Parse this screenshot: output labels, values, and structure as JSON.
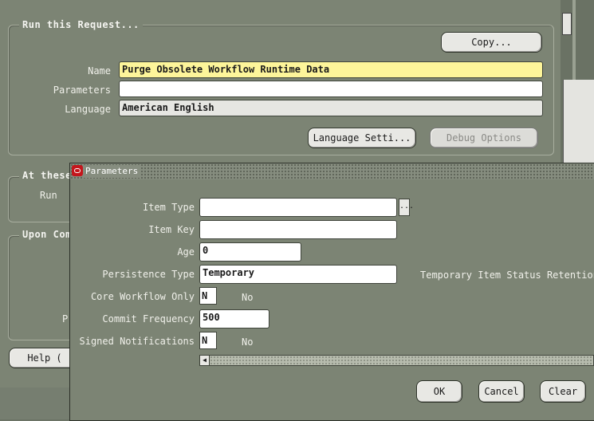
{
  "main": {
    "run_group_title": "Run this Request...",
    "copy_button": "Copy...",
    "name_label": "Name",
    "name_value": "Purge Obsolete Workflow Runtime Data",
    "parameters_label": "Parameters",
    "parameters_value": "",
    "language_label": "Language",
    "language_value": "American English",
    "language_settings_button": "Language Setti...",
    "debug_options_button": "Debug Options",
    "at_these_group_title": "At these",
    "run_label": "Run",
    "upon_group_title": "Upon Com",
    "p_label": "P",
    "help_button": "Help ("
  },
  "dialog": {
    "title": "Parameters",
    "item_type_label": "Item Type",
    "item_type_value": "",
    "lov_button": "...",
    "item_key_label": "Item Key",
    "item_key_value": "",
    "age_label": "Age",
    "age_value": "0",
    "persistence_type_label": "Persistence Type",
    "persistence_type_value": "Temporary",
    "persistence_desc": "Temporary Item Status Retention",
    "core_workflow_label": "Core Workflow Only",
    "core_workflow_value": "N",
    "core_workflow_desc": "No",
    "commit_frequency_label": "Commit Frequency",
    "commit_frequency_value": "500",
    "signed_notifications_label": "Signed Notifications",
    "signed_notifications_value": "N",
    "signed_notifications_desc": "No",
    "ok_button": "OK",
    "cancel_button": "Cancel",
    "clear_button": "Clear"
  }
}
